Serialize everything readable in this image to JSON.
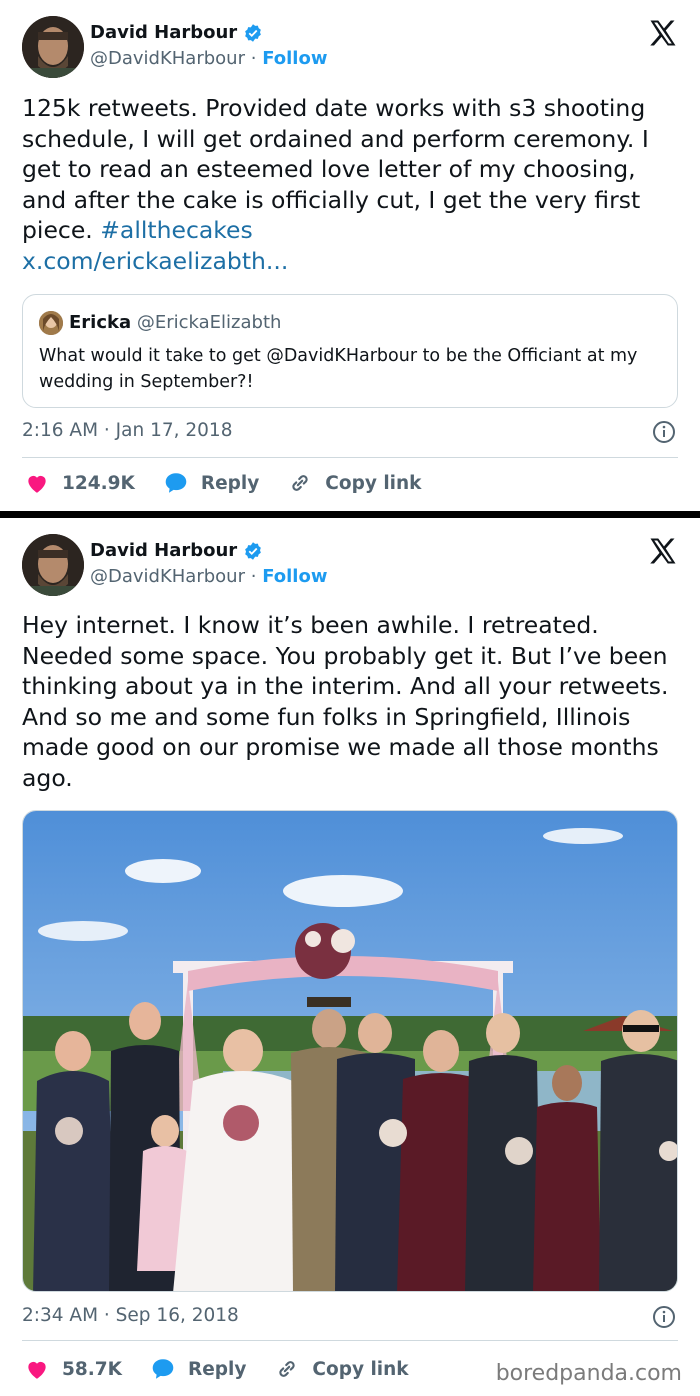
{
  "tweets": [
    {
      "author": {
        "name": "David Harbour",
        "handle": "@DavidKHarbour",
        "follow_label": "Follow",
        "verified": true
      },
      "text_main": "125k retweets.  Provided date works with s3 shooting schedule, I will get ordained and perform ceremony.  I get to read an esteemed love letter of my choosing, and after the cake is officially cut, I get the very first piece. ",
      "hashtag": "#allthecakes",
      "link": "x.com/erickaelizabth...",
      "quote": {
        "name": "Ericka",
        "handle": "@ErickaElizabth",
        "text": "What would it take to get @DavidKHarbour to be the Officiant at my wedding in September?!"
      },
      "timestamp": "2:16 AM · Jan 17, 2018",
      "likes": "124.9K",
      "reply_label": "Reply",
      "copy_label": "Copy link"
    },
    {
      "author": {
        "name": "David Harbour",
        "handle": "@DavidKHarbour",
        "follow_label": "Follow",
        "verified": true
      },
      "text_main": "Hey internet.  I know it’s been awhile.  I retreated.  Needed some space.  You probably get it.  But I’ve been thinking about ya in the interim.  And all your retweets.  And so me and some fun folks in Springfield, Illinois made good on our promise we made all those months ago.",
      "timestamp": "2:34 AM · Sep 16, 2018",
      "likes": "58.7K",
      "reply_label": "Reply",
      "copy_label": "Copy link"
    }
  ],
  "watermark": "boredpanda.com",
  "icons": {
    "verified": "verified-badge-icon",
    "x_logo": "x-logo-icon",
    "like": "heart-icon",
    "reply": "reply-bubble-icon",
    "copy": "link-icon",
    "info": "info-icon"
  },
  "colors": {
    "accent": "#1d9bf0",
    "like": "#f91880",
    "text": "#0f1419",
    "muted": "#536471"
  }
}
